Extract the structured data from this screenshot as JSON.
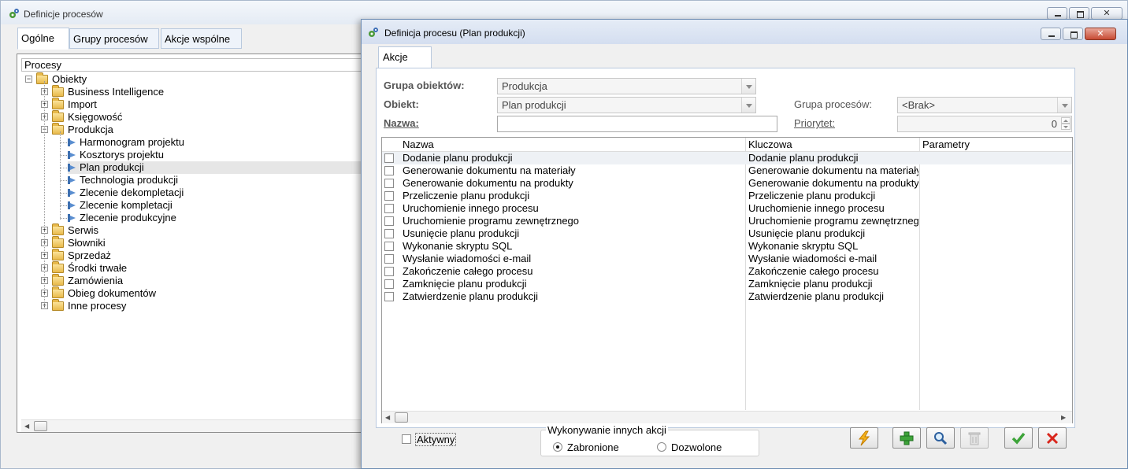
{
  "main_window": {
    "title": "Definicje procesów",
    "tabs": [
      "Ogólne",
      "Grupy procesów",
      "Akcje wspólne"
    ],
    "tree_header": "Procesy",
    "tree": [
      {
        "label": "Obiekty",
        "level": 0,
        "kind": "folder",
        "expander": "−"
      },
      {
        "label": "Business Intelligence",
        "level": 1,
        "kind": "folder",
        "expander": "+"
      },
      {
        "label": "Import",
        "level": 1,
        "kind": "folder",
        "expander": "+"
      },
      {
        "label": "Księgowość",
        "level": 1,
        "kind": "folder",
        "expander": "+"
      },
      {
        "label": "Produkcja",
        "level": 1,
        "kind": "folder",
        "expander": "−"
      },
      {
        "label": "Harmonogram projektu",
        "level": 2,
        "kind": "process"
      },
      {
        "label": "Kosztorys projektu",
        "level": 2,
        "kind": "process"
      },
      {
        "label": "Plan produkcji",
        "level": 2,
        "kind": "process",
        "selected": true
      },
      {
        "label": "Technologia produkcji",
        "level": 2,
        "kind": "process"
      },
      {
        "label": "Zlecenie dekompletacji",
        "level": 2,
        "kind": "process"
      },
      {
        "label": "Zlecenie kompletacji",
        "level": 2,
        "kind": "process"
      },
      {
        "label": "Zlecenie produkcyjne",
        "level": 2,
        "kind": "process"
      },
      {
        "label": "Serwis",
        "level": 1,
        "kind": "folder",
        "expander": "+"
      },
      {
        "label": "Słowniki",
        "level": 1,
        "kind": "folder",
        "expander": "+"
      },
      {
        "label": "Sprzedaż",
        "level": 1,
        "kind": "folder",
        "expander": "+"
      },
      {
        "label": "Środki trwałe",
        "level": 1,
        "kind": "folder",
        "expander": "+"
      },
      {
        "label": "Zamówienia",
        "level": 1,
        "kind": "folder",
        "expander": "+"
      },
      {
        "label": "Obieg dokumentów",
        "level": 1,
        "kind": "folder",
        "expander": "+"
      },
      {
        "label": "Inne procesy",
        "level": 1,
        "kind": "folder",
        "expander": "+"
      }
    ]
  },
  "dialog": {
    "title": "Definicja procesu (Plan produkcji)",
    "tab": "Akcje",
    "fields": {
      "grupa_obiektow_label": "Grupa obiektów:",
      "grupa_obiektow_value": "Produkcja",
      "obiekt_label": "Obiekt:",
      "obiekt_value": "Plan produkcji",
      "nazwa_label": "Nazwa:",
      "nazwa_value": "",
      "grupa_procesow_label": "Grupa procesów:",
      "grupa_procesow_value": "<Brak>",
      "priorytet_label": "Priorytet:",
      "priorytet_value": "0"
    },
    "grid": {
      "columns": [
        "Nazwa",
        "Kluczowa",
        "Parametry"
      ],
      "rows": [
        {
          "nazwa": "Dodanie planu produkcji",
          "kluczowa": "Dodanie planu produkcji"
        },
        {
          "nazwa": "Generowanie dokumentu na materiały",
          "kluczowa": "Generowanie dokumentu na materiały"
        },
        {
          "nazwa": "Generowanie dokumentu na produkty",
          "kluczowa": "Generowanie dokumentu na produkty"
        },
        {
          "nazwa": "Przeliczenie planu produkcji",
          "kluczowa": "Przeliczenie planu produkcji"
        },
        {
          "nazwa": "Uruchomienie innego procesu",
          "kluczowa": "Uruchomienie innego procesu"
        },
        {
          "nazwa": "Uruchomienie programu zewnętrznego",
          "kluczowa": "Uruchomienie programu zewnętrznego"
        },
        {
          "nazwa": "Usunięcie planu produkcji",
          "kluczowa": "Usunięcie planu produkcji"
        },
        {
          "nazwa": "Wykonanie skryptu SQL",
          "kluczowa": "Wykonanie skryptu SQL"
        },
        {
          "nazwa": "Wysłanie wiadomości e-mail",
          "kluczowa": "Wysłanie wiadomości e-mail"
        },
        {
          "nazwa": "Zakończenie całego procesu",
          "kluczowa": "Zakończenie całego procesu"
        },
        {
          "nazwa": "Zamknięcie planu produkcji",
          "kluczowa": "Zamknięcie planu produkcji"
        },
        {
          "nazwa": "Zatwierdzenie planu produkcji",
          "kluczowa": "Zatwierdzenie planu produkcji"
        }
      ]
    },
    "aktywny_label": "Aktywny",
    "aktywny_checked": false,
    "group_title": "Wykonywanie innych akcji",
    "radio_zabronione": "Zabronione",
    "radio_dozwolone": "Dozwolone",
    "selected_radio": "Zabronione",
    "toolbar_icons": [
      "lightning-icon",
      "plus-icon",
      "search-icon",
      "trash-icon",
      "checkmark-icon",
      "cross-icon"
    ]
  }
}
